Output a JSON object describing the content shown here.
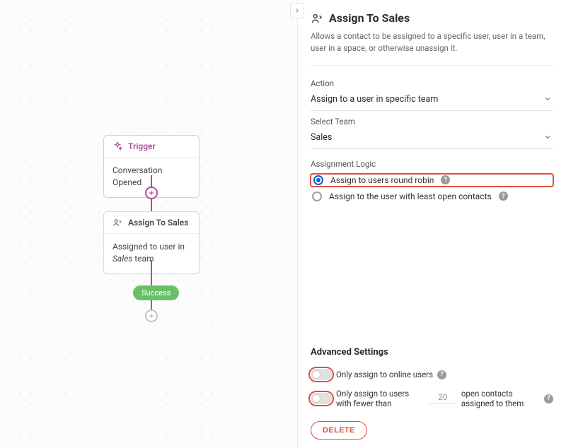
{
  "canvas": {
    "trigger": {
      "title": "Trigger",
      "body": "Conversation Opened"
    },
    "assign": {
      "title": "Assign To Sales",
      "body_prefix": "Assigned to user in ",
      "body_team": "Sales",
      "body_suffix": " team"
    },
    "success_label": "Success"
  },
  "panel": {
    "title": "Assign To Sales",
    "description": "Allows a contact to be assigned to a specific user, user in a team, user in a space, or otherwise unassign it.",
    "action_label": "Action",
    "action_value": "Assign to a user in specific team",
    "team_label": "Select Team",
    "team_value": "Sales",
    "logic_label": "Assignment Logic",
    "logic_options": {
      "round_robin": "Assign to users round robin",
      "least_open": "Assign to the user with least open contacts"
    },
    "advanced_title": "Advanced Settings",
    "toggle_online": "Only assign to online users",
    "toggle_fewer_prefix": "Only assign to users with fewer than",
    "toggle_fewer_value": "20",
    "toggle_fewer_suffix": "open contacts assigned to them",
    "delete_label": "DELETE"
  }
}
